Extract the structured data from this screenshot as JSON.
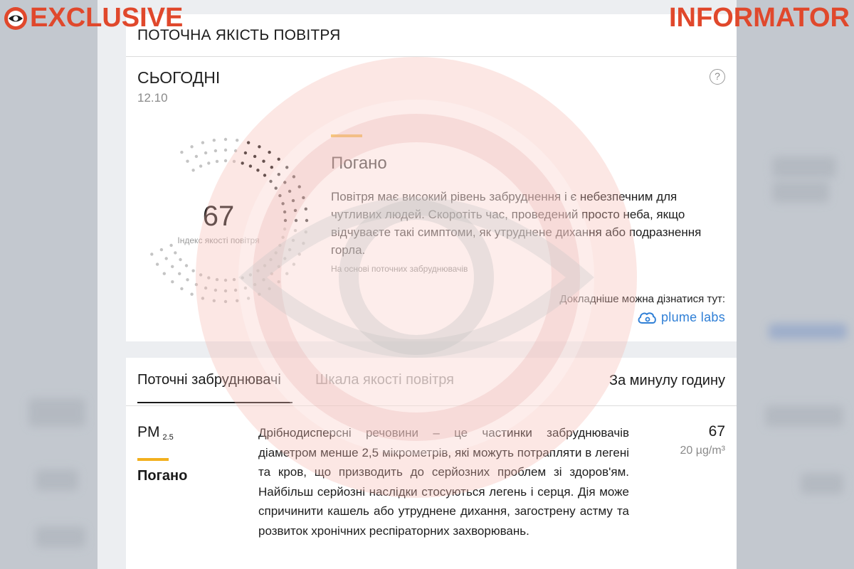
{
  "watermark": {
    "left_brand": "EXCLUSIVE",
    "right_brand": "INFORMATOR",
    "color": "#e0482c"
  },
  "current": {
    "title": "ПОТОЧНА ЯКІСТЬ ПОВІТРЯ",
    "today_label": "СЬОГОДНІ",
    "date": "12.10",
    "help_icon": "?",
    "aqi_value": "67",
    "aqi_label": "Індекс якості повітря",
    "aqi_scale_max": 100,
    "status": "Погано",
    "description": "Повітря має високий рівень забруднення і є небезпечним для чутливих людей. Скоротіть час, проведений просто неба, якщо відчуваєте такі симптоми, як утруднене дихання або подразнення горла.",
    "note": "На основі поточних забруднювачів",
    "more_info_label": "Докладніше можна дізнатися тут:",
    "provider": "plume labs",
    "accent_color": "#f2b01e",
    "provider_color": "#2f7fd6"
  },
  "pollutants": {
    "tabs": [
      {
        "label": "Поточні забруднювачі",
        "active": true
      },
      {
        "label": "Шкала якості повітря",
        "active": false
      }
    ],
    "period": "За минулу годину",
    "items": [
      {
        "name": "PM",
        "subscript": "2.5",
        "status": "Погано",
        "description": "Дрібнодисперсні речовини – це частинки забруднювачів діаметром менше 2,5 мікрометрів, які можуть потрапляти в легені та кров, що призводить до серйозних проблем зі здоров'ям. Найбільш серйозні наслідки стосуються легень і серця. Дія може спричинити кашель або утруднене дихання, загострену астму та розвиток хронічних респіраторних захворювань.",
        "index": "67",
        "concentration": "20 µg/m³"
      }
    ]
  }
}
